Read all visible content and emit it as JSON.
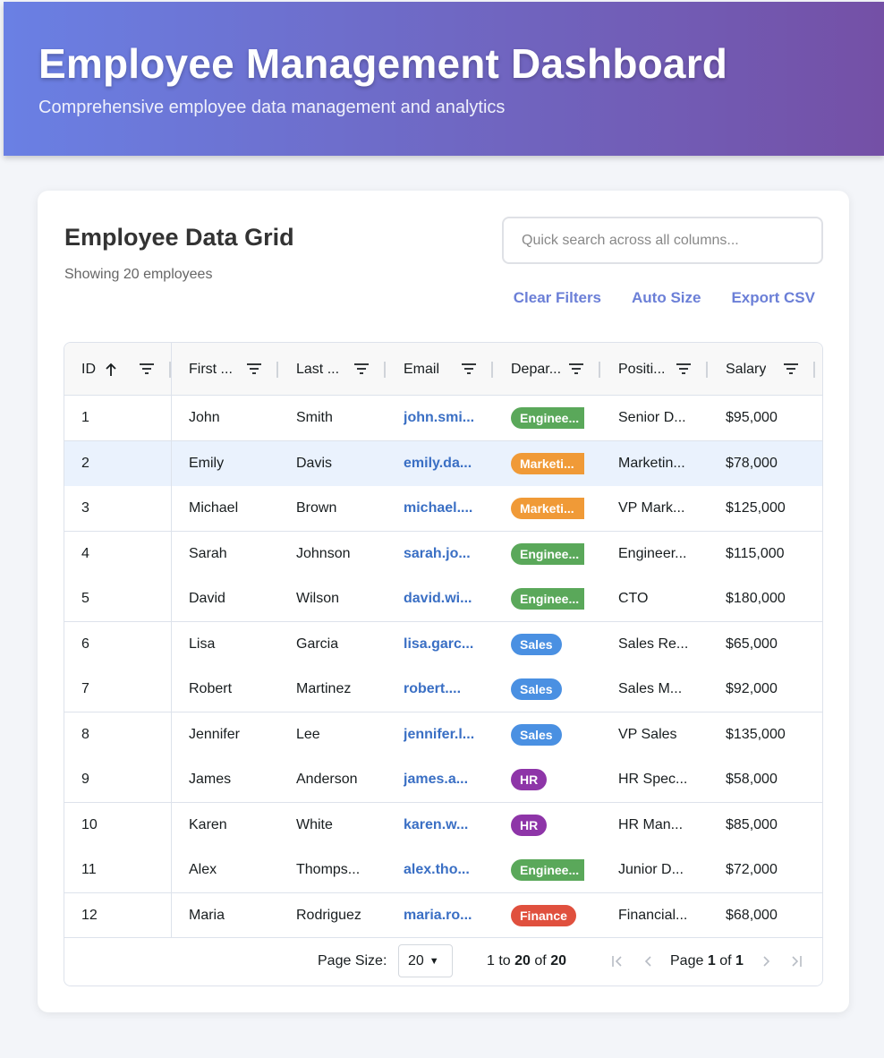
{
  "header": {
    "title": "Employee Management Dashboard",
    "subtitle": "Comprehensive employee data management and analytics"
  },
  "card": {
    "title": "Employee Data Grid",
    "subtitle": "Showing 20 employees",
    "search_placeholder": "Quick search across all columns...",
    "buttons": {
      "clear_filters": "Clear Filters",
      "auto_size": "Auto Size",
      "export_csv": "Export CSV"
    }
  },
  "grid": {
    "columns": [
      "ID",
      "First ...",
      "Last ...",
      "Email",
      "Depar...",
      "Positi...",
      "Salary"
    ],
    "sorted_column": "ID",
    "sort_direction": "ascending",
    "rows": [
      {
        "id": "1",
        "first": "John",
        "last": "Smith",
        "email": "john.smi...",
        "dept": "Enginee...",
        "dept_color": "#5aa85a",
        "position": "Senior D...",
        "salary": "$95,000"
      },
      {
        "id": "2",
        "first": "Emily",
        "last": "Davis",
        "email": "emily.da...",
        "dept": "Marketi...",
        "dept_color": "#f09a37",
        "position": "Marketin...",
        "salary": "$78,000"
      },
      {
        "id": "3",
        "first": "Michael",
        "last": "Brown",
        "email": "michael....",
        "dept": "Marketi...",
        "dept_color": "#f09a37",
        "position": "VP Mark...",
        "salary": "$125,000"
      },
      {
        "id": "4",
        "first": "Sarah",
        "last": "Johnson",
        "email": "sarah.jo...",
        "dept": "Enginee...",
        "dept_color": "#5aa85a",
        "position": "Engineer...",
        "salary": "$115,000"
      },
      {
        "id": "5",
        "first": "David",
        "last": "Wilson",
        "email": "david.wi...",
        "dept": "Enginee...",
        "dept_color": "#5aa85a",
        "position": "CTO",
        "salary": "$180,000"
      },
      {
        "id": "6",
        "first": "Lisa",
        "last": "Garcia",
        "email": "lisa.garc...",
        "dept": "Sales",
        "dept_color": "#4a90e2",
        "position": "Sales Re...",
        "salary": "$65,000"
      },
      {
        "id": "7",
        "first": "Robert",
        "last": "Martinez",
        "email": "robert....",
        "dept": "Sales",
        "dept_color": "#4a90e2",
        "position": "Sales M...",
        "salary": "$92,000"
      },
      {
        "id": "8",
        "first": "Jennifer",
        "last": "Lee",
        "email": "jennifer.l...",
        "dept": "Sales",
        "dept_color": "#4a90e2",
        "position": "VP Sales",
        "salary": "$135,000"
      },
      {
        "id": "9",
        "first": "James",
        "last": "Anderson",
        "email": "james.a...",
        "dept": "HR",
        "dept_color": "#8e35a8",
        "position": "HR Spec...",
        "salary": "$58,000"
      },
      {
        "id": "10",
        "first": "Karen",
        "last": "White",
        "email": "karen.w...",
        "dept": "HR",
        "dept_color": "#8e35a8",
        "position": "HR Man...",
        "salary": "$85,000"
      },
      {
        "id": "11",
        "first": "Alex",
        "last": "Thomps...",
        "email": "alex.tho...",
        "dept": "Enginee...",
        "dept_color": "#5aa85a",
        "position": "Junior D...",
        "salary": "$72,000"
      },
      {
        "id": "12",
        "first": "Maria",
        "last": "Rodriguez",
        "email": "maria.ro...",
        "dept": "Finance",
        "dept_color": "#e0503e",
        "position": "Financial...",
        "salary": "$68,000"
      }
    ],
    "selected_row": 1,
    "footer": {
      "page_size_label": "Page Size:",
      "page_size": "20",
      "range_from": "1",
      "range_to_word": "to",
      "range_to": "20",
      "range_of_word": "of",
      "range_total": "20",
      "page_word": "Page",
      "page_current": "1",
      "page_of_word": "of",
      "page_total": "1"
    }
  },
  "icons": {
    "sort": "arrow-up-icon",
    "filter": "filter-icon",
    "first_page": "first-page-icon",
    "prev_page": "chevron-left-icon",
    "next_page": "chevron-right-icon",
    "last_page": "last-page-icon"
  },
  "colors": {
    "header_gradient_start": "#6a80e4",
    "header_gradient_end": "#7450a6",
    "accent": "#6b7fd7",
    "email_link": "#3a6fc4",
    "selected_row": "#eaf2fd"
  }
}
